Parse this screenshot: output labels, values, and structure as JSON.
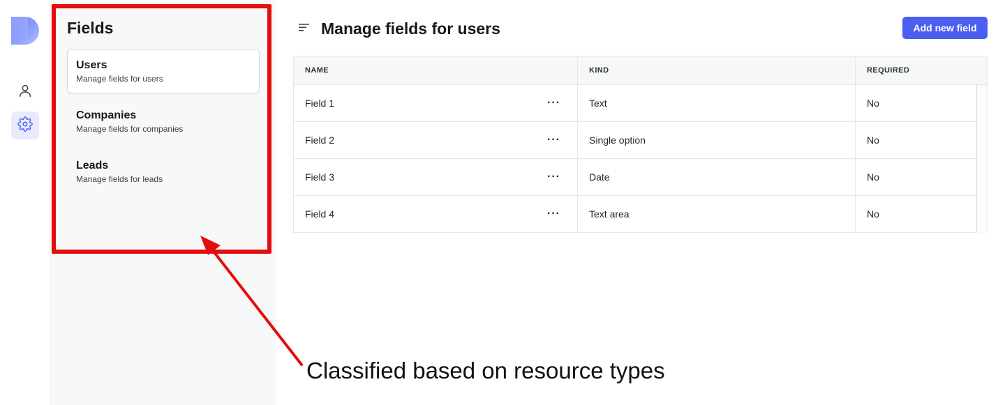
{
  "rail": {
    "icons": [
      "logo",
      "person-icon",
      "gear-icon"
    ],
    "active": "gear-icon"
  },
  "panel": {
    "title": "Fields",
    "items": [
      {
        "label": "Users",
        "subtitle": "Manage fields for users",
        "active": true
      },
      {
        "label": "Companies",
        "subtitle": "Manage fields for companies",
        "active": false
      },
      {
        "label": "Leads",
        "subtitle": "Manage fields for leads",
        "active": false
      }
    ]
  },
  "main": {
    "title": "Manage fields for users",
    "add_button": "Add new field",
    "table": {
      "headers": [
        "NAME",
        "KIND",
        "REQUIRED"
      ],
      "rows": [
        {
          "name": "Field 1",
          "kind": "Text",
          "required": "No"
        },
        {
          "name": "Field 2",
          "kind": "Single option",
          "required": "No"
        },
        {
          "name": "Field 3",
          "kind": "Date",
          "required": "No"
        },
        {
          "name": "Field 4",
          "kind": "Text area",
          "required": "No"
        }
      ],
      "row_actions_icon": "more-horizontal-icon"
    }
  },
  "annotation": {
    "caption": "Classified based on resource types",
    "color": "#e30d0d"
  },
  "colors": {
    "accent": "#4a5ff0",
    "active_rail_bg": "#e9ebfd",
    "panel_bg": "#f7f8f8"
  }
}
